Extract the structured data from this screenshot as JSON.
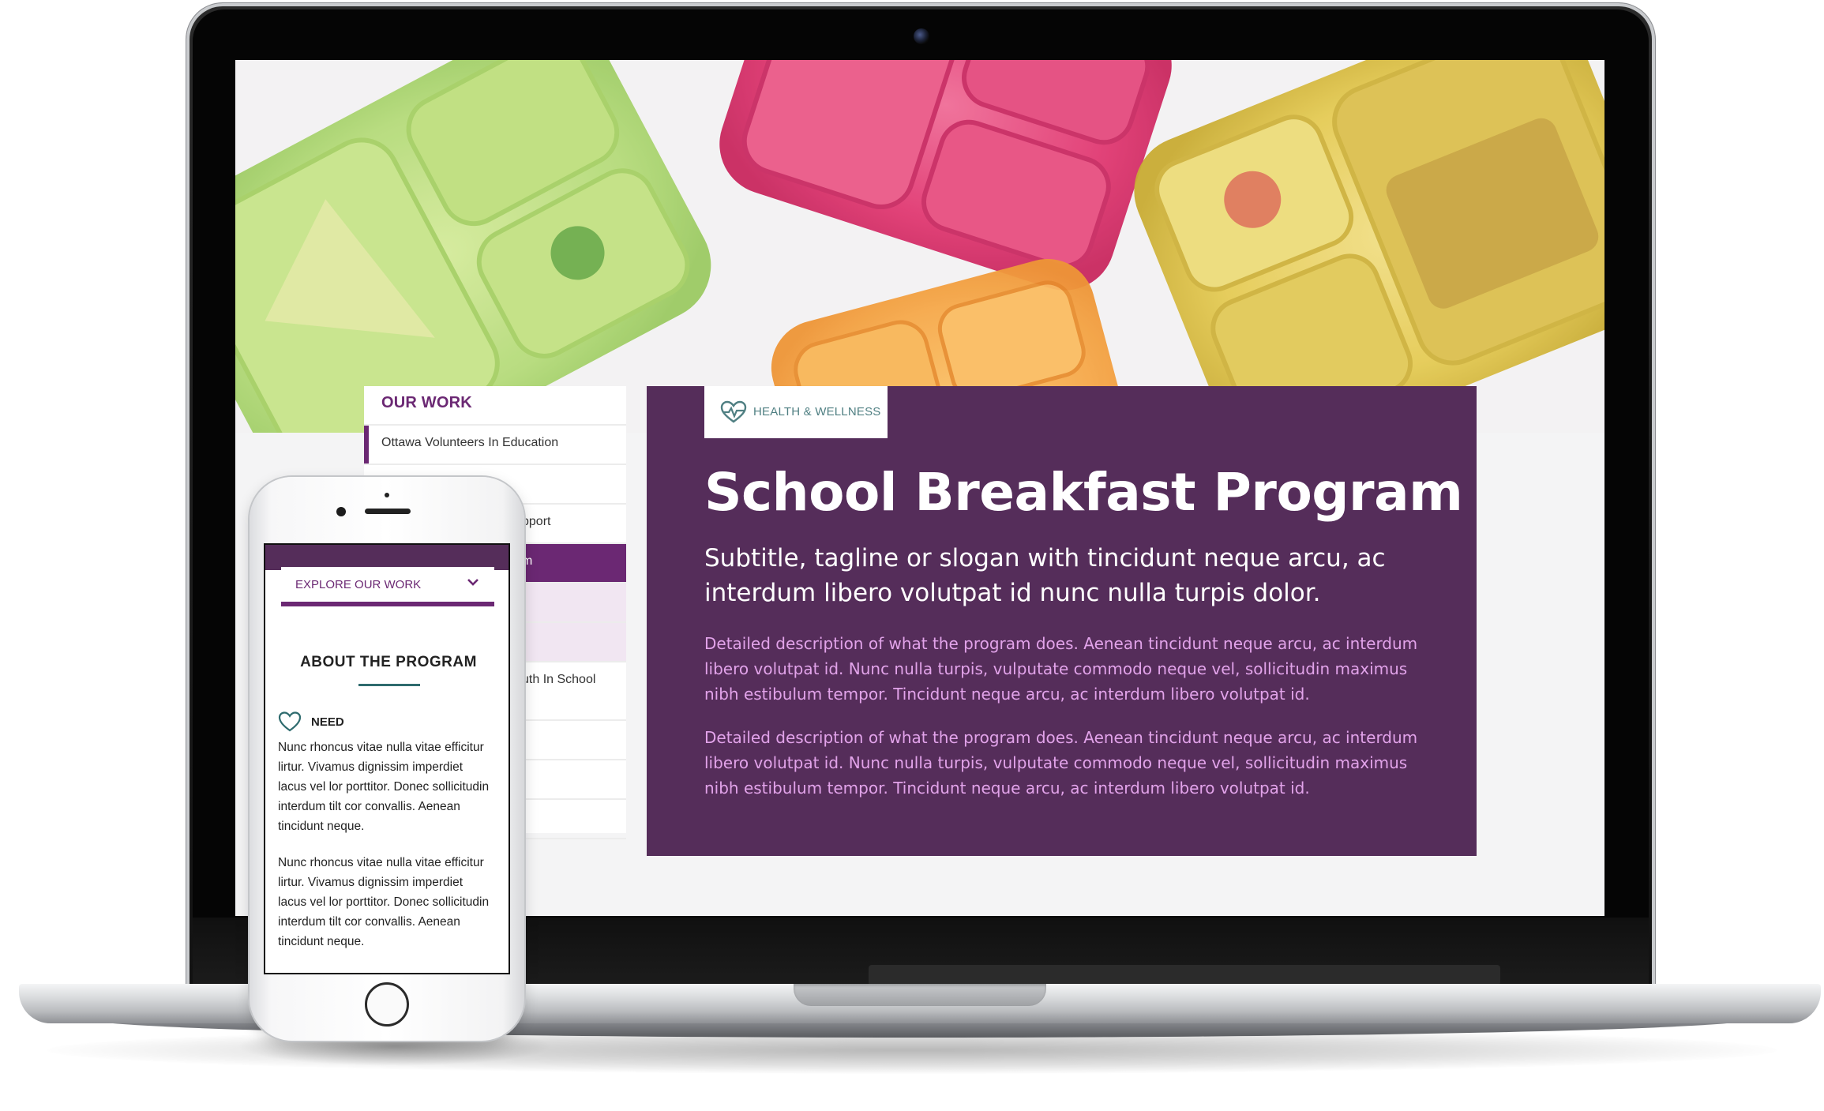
{
  "colors": {
    "brand_purple": "#552d5a",
    "accent_purple": "#6b2873",
    "teal": "#2e6b6e",
    "description_pink": "#e2a3ea"
  },
  "desktop": {
    "side_nav": {
      "title": "OUR WORK",
      "items": [
        {
          "label": "Ottawa Volunteers In Education",
          "state": "default"
        },
        {
          "label": "",
          "state": "default"
        },
        {
          "label": "pport",
          "state": "default"
        },
        {
          "label": "m",
          "state": "active"
        },
        {
          "label": "",
          "state": "sub"
        },
        {
          "label": "",
          "state": "sub"
        },
        {
          "label": "uth In School",
          "state": "default"
        },
        {
          "label": "",
          "state": "default"
        },
        {
          "label": "",
          "state": "default"
        },
        {
          "label": "",
          "state": "default"
        }
      ]
    },
    "card": {
      "tag_icon": "heartbeat-icon",
      "tag_label": "HEALTH & WELLNESS",
      "title": "School Breakfast Program",
      "subtitle": "Subtitle, tagline or slogan with tincidunt neque arcu, ac interdum libero volutpat id nunc nulla turpis dolor.",
      "descriptions": [
        "Detailed description of what the program does. Aenean tincidunt neque arcu, ac interdum libero volutpat id. Nunc nulla turpis, vulputate commodo neque vel, sollicitudin maximus nibh estibulum tempor. Tincidunt neque arcu, ac interdum libero volutpat id.",
        "Detailed description of what the program does. Aenean tincidunt neque arcu, ac interdum libero volutpat id. Nunc nulla turpis, vulputate commodo neque vel, sollicitudin maximus nibh estibulum tempor. Tincidunt neque arcu, ac interdum libero volutpat id."
      ]
    }
  },
  "mobile": {
    "explore_label": "EXPLORE OUR WORK",
    "explore_icon": "chevron-down-icon",
    "about_heading": "ABOUT THE PROGRAM",
    "need_icon": "heart-icon",
    "need_label": "NEED",
    "paragraphs": [
      "Nunc rhoncus vitae nulla vitae efficitur lirtur. Vivamus dignissim imperdiet lacus vel lor porttitor. Donec sollicitudin interdum tilt cor convallis. Aenean tincidunt neque.",
      "Nunc rhoncus vitae nulla vitae efficitur lirtur. Vivamus dignissim imperdiet lacus vel lor porttitor. Donec sollicitudin interdum tilt cor convallis. Aenean tincidunt neque."
    ]
  }
}
